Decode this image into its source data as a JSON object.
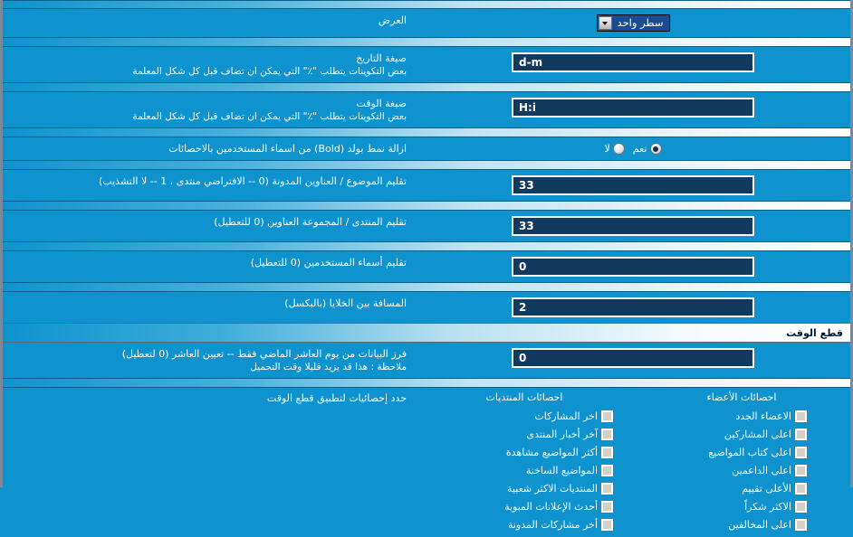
{
  "window": {
    "background_color": "#0e93cf",
    "input_color": "#123a5e",
    "border_color": "#7a8a9a"
  },
  "rows": [
    {
      "label": "العرض",
      "sub": "",
      "control": "select",
      "value": "سطر واحد",
      "options": [
        "سطر واحد"
      ]
    },
    {
      "label": "صيغة التاريخ",
      "sub": "بعض التكوينات يتطلب \"٪\" التي يمكن ان تضاف قبل كل شكل المعلمة",
      "control": "text",
      "value": "d-m"
    },
    {
      "label": "صيغة الوقت",
      "sub": "بعض التكوينات يتطلب \"٪\" التي يمكن ان تضاف قبل كل شكل المعلمة",
      "control": "text",
      "value": "H:i"
    },
    {
      "label": "ازالة نمط بولد (Bold) من اسماء المستخدمين بالاحصائات",
      "sub": "",
      "control": "radio",
      "options": [
        {
          "label": "نعم",
          "selected": true
        },
        {
          "label": "لا",
          "selected": false
        }
      ]
    },
    {
      "label": "تقليم الموضوع / العناوين المدونة (0 -- الافتراضي منتدى ، 1 -- لا التشذيب)",
      "sub": "",
      "control": "text",
      "value": "33"
    },
    {
      "label": "تقليم المنتدى / المجموعة العناوين (0 للتعطيل)",
      "sub": "",
      "control": "text",
      "value": "33"
    },
    {
      "label": "تقليم أسماء المستخدمين (0 للتعطيل)",
      "sub": "",
      "control": "text",
      "value": "0"
    },
    {
      "label": "المسافة بين الخلايا (بالبكسل)",
      "sub": "",
      "control": "text",
      "value": "2"
    }
  ],
  "section": {
    "title": "قطع الوقت",
    "cutoff_row": {
      "label": "فرز البيانات من يوم العاشر الماضي فقط -- تعيين العاشر (0 لتعطيل)",
      "sub": "ملاحظة : هذا قد يزيد قليلا وقت التحميل",
      "value": "0"
    },
    "checks_label": "حدد إحصائيات لتطبيق قطع الوقت",
    "columns": [
      {
        "heading": "احصائات الأعضاء",
        "items": [
          "الاعضاء الجدد",
          "اعلى المشاركين",
          "اعلى كتاب المواضيع",
          "اعلى الداعمين",
          "الأعلى تقييم",
          "الاكثر شكراً",
          "اعلى المخالفين"
        ]
      },
      {
        "heading": "احصائات المنتديات",
        "items": [
          "اخر المشاركات",
          "آخر أخبار المنتدى",
          "أكثر المواضيع مشاهدة",
          "المواضيع الساخنة",
          "المنتديات الاكثر شعبية",
          "أحدث الإعلانات المبوبة",
          "أخر مشاركات المدونة"
        ]
      }
    ]
  }
}
